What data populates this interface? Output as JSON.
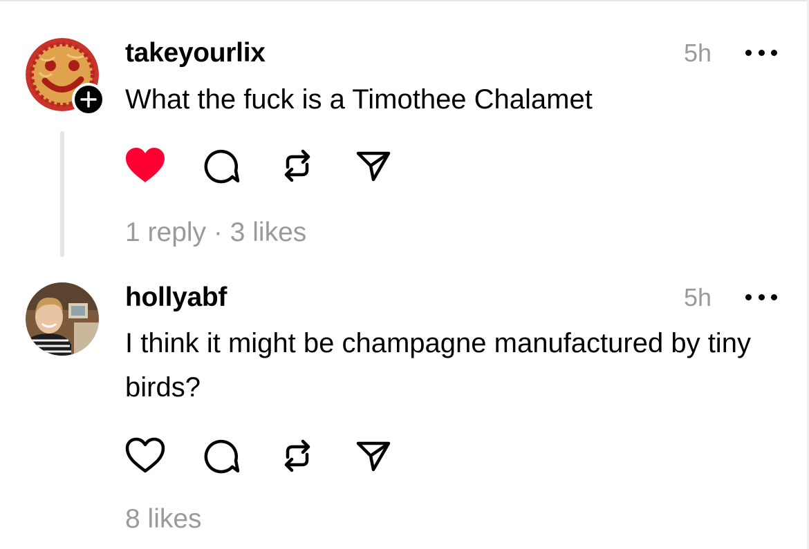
{
  "posts": [
    {
      "username": "takeyourlix",
      "time": "5h",
      "text": "What the fuck is a Timothee Chalamet",
      "liked": true,
      "stats": "1 reply · 3 likes",
      "avatar_icon": "pizza-smiley-avatar",
      "has_follow_badge": true
    },
    {
      "username": "hollyabf",
      "time": "5h",
      "text": "I think it might be champagne manufactured by tiny birds?",
      "liked": false,
      "stats": "8 likes",
      "avatar_icon": "profile-photo-avatar",
      "has_follow_badge": false
    }
  ],
  "colors": {
    "like_red": "#ff0033",
    "secondary_text": "#9a9a9a",
    "thread_line": "#e4e4e4"
  }
}
